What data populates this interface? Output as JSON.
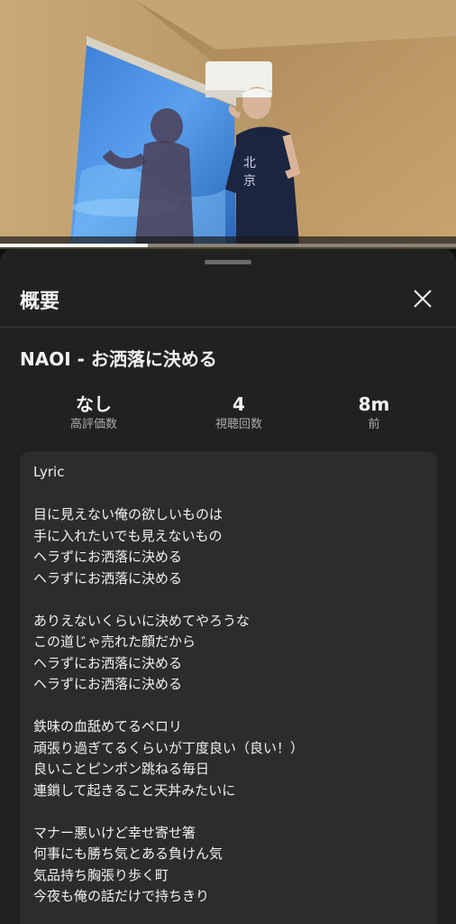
{
  "video": {
    "progress_fraction": 0.325
  },
  "sheet": {
    "title": "概要",
    "close_icon": "close-icon"
  },
  "video_info": {
    "title": "NAOI - お洒落に決める",
    "stats": [
      {
        "value": "なし",
        "label": "高評価数"
      },
      {
        "value": "4",
        "label": "視聴回数"
      },
      {
        "value": "8m",
        "label": "前"
      }
    ]
  },
  "description": {
    "lines": [
      "Lyric",
      "",
      "目に見えない俺の欲しいものは",
      "手に入れたいでも見えないもの",
      "ヘラずにお洒落に決める",
      "ヘラずにお洒落に決める",
      "",
      "ありえないくらいに決めてやろうな",
      "この道じゃ売れた顔だから",
      "ヘラずにお洒落に決める",
      "ヘラずにお洒落に決める",
      "",
      "鉄味の血舐めてるペロリ",
      "頑張り過ぎてるくらいが丁度良い（良い！）",
      "良いことピンポン跳ねる毎日",
      "連鎖して起きること天丼みたいに",
      "",
      "マナー悪いけど幸せ寄せ箸",
      "何事にも勝ち気とある負けん気",
      "気品持ち胸張り歩く町",
      "今夜も俺の話だけで持ちきり"
    ]
  },
  "colors": {
    "background": "#0f0f0f",
    "sheet": "#212121",
    "description_box": "#2c2c2c",
    "secondary_text": "#aaaaaa"
  }
}
